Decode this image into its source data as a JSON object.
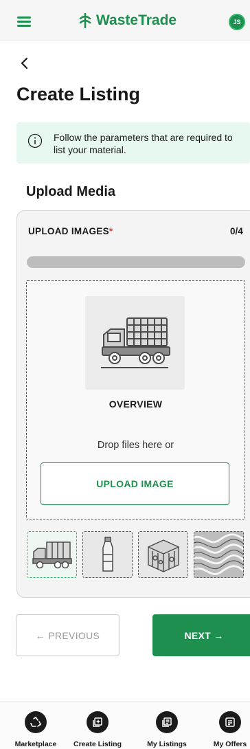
{
  "header": {
    "brand": "WasteTrade",
    "avatar_initials": "JS",
    "brand_color": "#1f8f50"
  },
  "page": {
    "title": "Create Listing"
  },
  "info": {
    "text": "Follow the parameters that are required to list your material."
  },
  "upload_media": {
    "section_title": "Upload Media",
    "label": "UPLOAD IMAGES",
    "required_mark": "*",
    "count": "0/4",
    "progress_fraction": 0,
    "preview_caption": "OVERVIEW",
    "drop_text": "Drop files here or",
    "upload_button": "UPLOAD IMAGE",
    "thumbnails": [
      {
        "icon": "truck-icon"
      },
      {
        "icon": "bottle-icon"
      },
      {
        "icon": "bale-icon"
      },
      {
        "icon": "texture-icon"
      }
    ]
  },
  "actions": {
    "previous": "← PREVIOUS",
    "next": "NEXT →"
  },
  "bottom_nav": {
    "items": [
      {
        "label": "Marketplace",
        "icon": "recycle-icon"
      },
      {
        "label": "Create Listing",
        "icon": "add-listing-icon"
      },
      {
        "label": "My Listings",
        "icon": "listings-icon"
      },
      {
        "label": "My Offers",
        "icon": "offers-icon"
      }
    ]
  }
}
